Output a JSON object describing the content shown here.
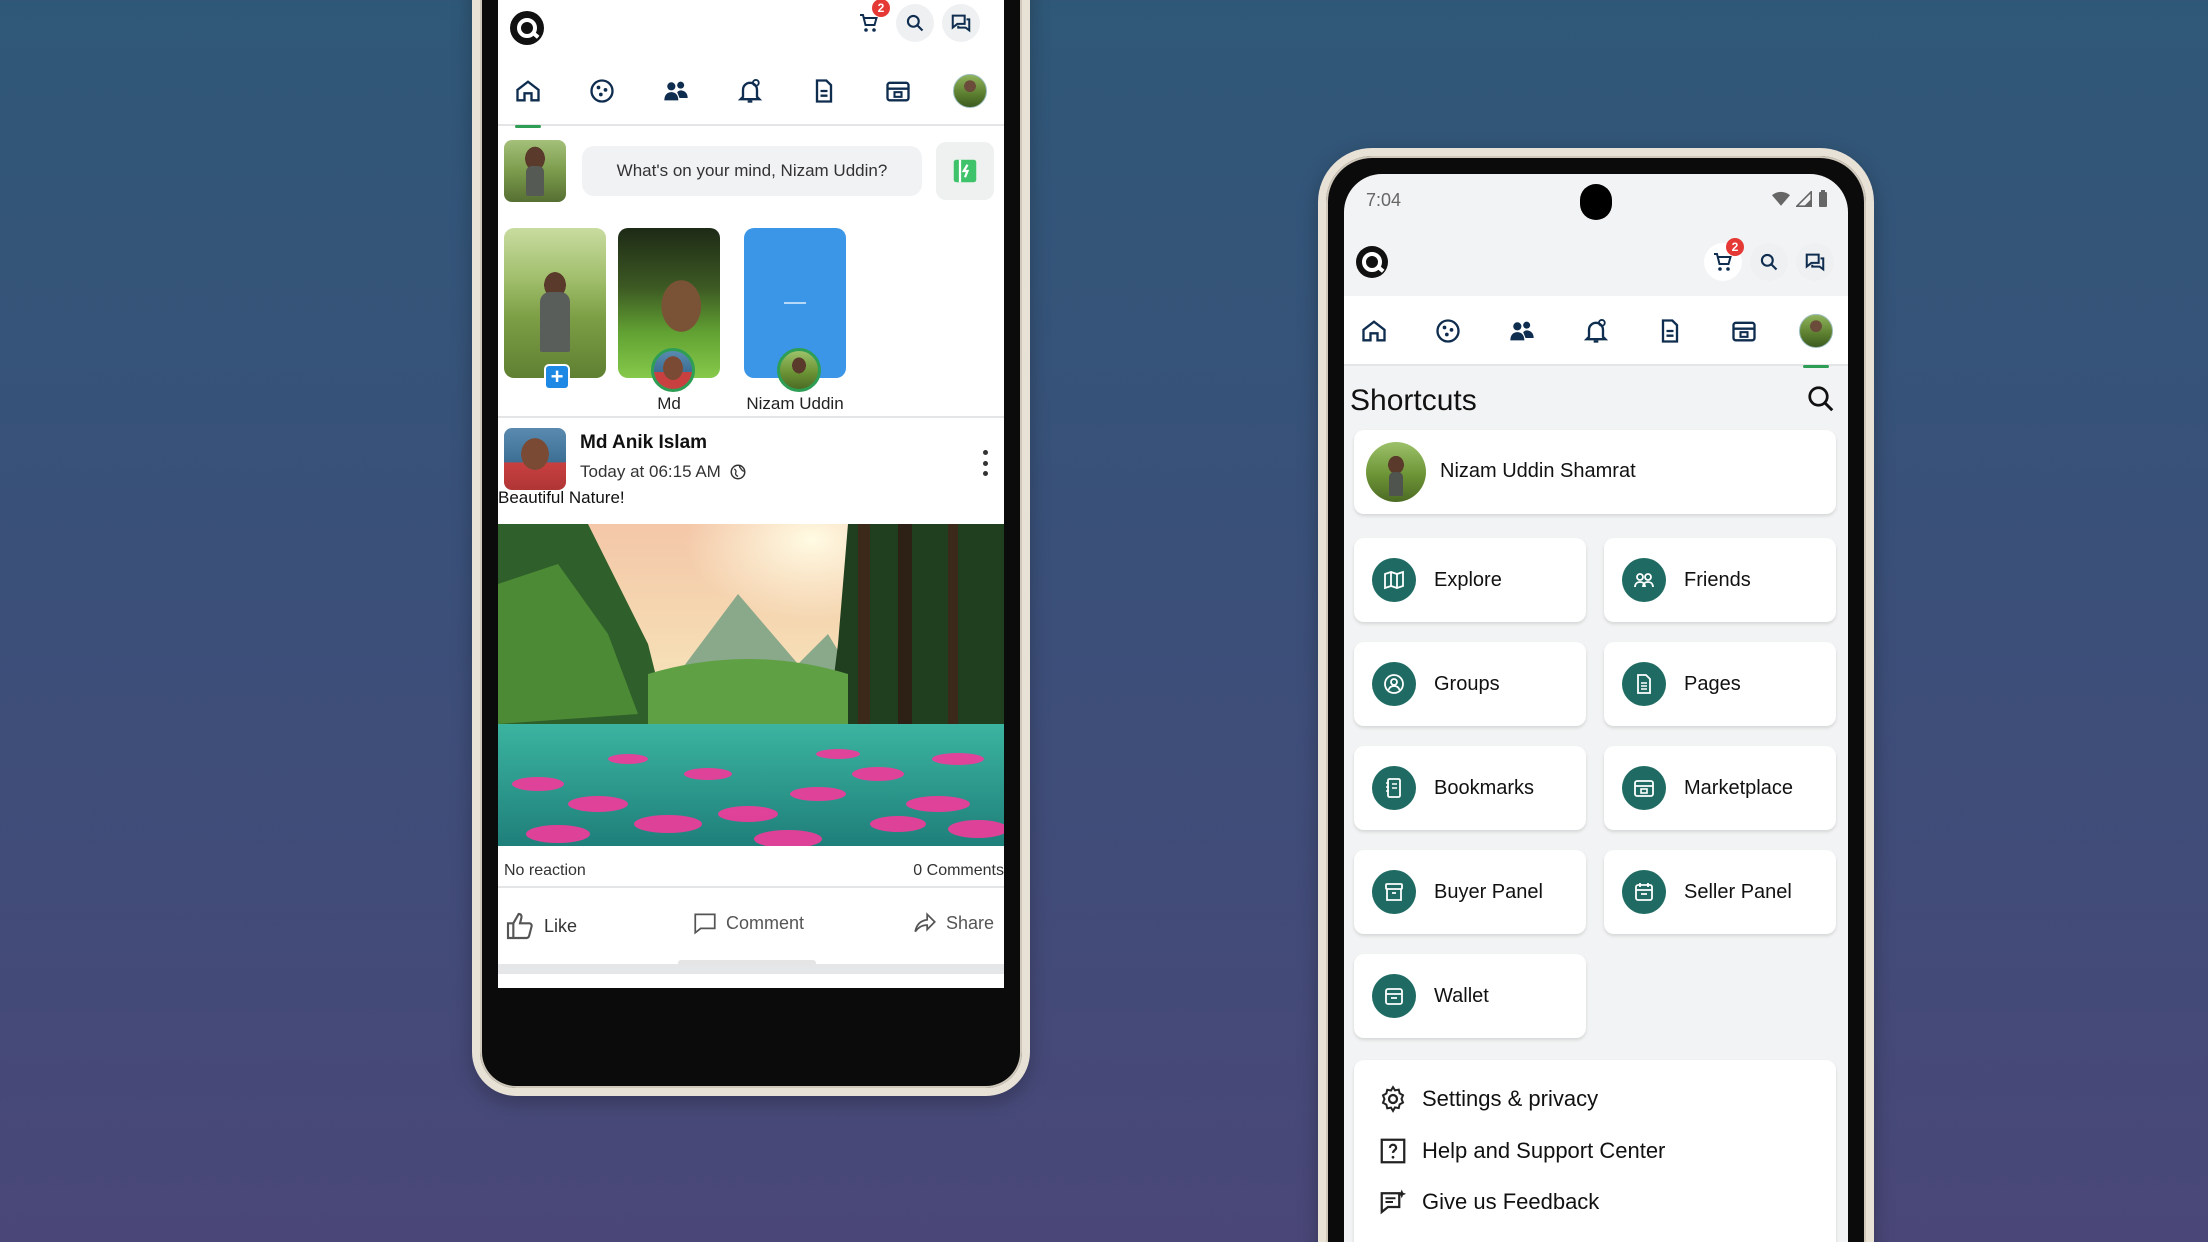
{
  "left": {
    "header": {
      "cart_badge": "2"
    },
    "composer": {
      "placeholder": "What's on your mind, Nizam Uddin?"
    },
    "stories": [
      {
        "label": ""
      },
      {
        "label": "Md"
      },
      {
        "label": "Nizam Uddin"
      }
    ],
    "post": {
      "author": "Md Anik  Islam",
      "time": "Today at 06:15 AM",
      "text": "Beautiful Nature!",
      "reactions": "No reaction",
      "comments": "0 Comments",
      "actions": {
        "like": "Like",
        "comment": "Comment",
        "share": "Share"
      }
    }
  },
  "right": {
    "status": {
      "time": "7:04"
    },
    "header": {
      "cart_badge": "2"
    },
    "shortcuts": {
      "title": "Shortcuts",
      "profile_name": "Nizam Uddin Shamrat",
      "items": [
        {
          "label": "Explore",
          "icon": "map-icon"
        },
        {
          "label": "Friends",
          "icon": "people-icon"
        },
        {
          "label": "Groups",
          "icon": "user-circle-icon"
        },
        {
          "label": "Pages",
          "icon": "page-icon"
        },
        {
          "label": "Bookmarks",
          "icon": "notebook-icon"
        },
        {
          "label": "Marketplace",
          "icon": "store-icon"
        },
        {
          "label": "Buyer Panel",
          "icon": "box-icon"
        },
        {
          "label": "Seller Panel",
          "icon": "calendar-box-icon"
        },
        {
          "label": "Wallet",
          "icon": "wallet-icon"
        }
      ],
      "menu": [
        {
          "label": "Settings & privacy",
          "icon": "gear-icon"
        },
        {
          "label": "Help and Support Center",
          "icon": "question-icon"
        },
        {
          "label": "Give us Feedback",
          "icon": "feedback-icon"
        }
      ]
    }
  },
  "colors": {
    "accent_green": "#2e9e55",
    "icon_dark": "#0f2d4f",
    "shortcut_icon_bg": "#1f6b63",
    "badge_red": "#e53935"
  }
}
